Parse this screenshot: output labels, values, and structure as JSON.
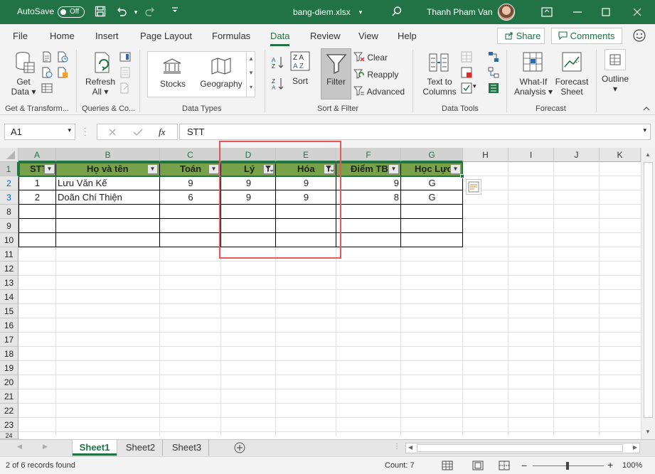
{
  "titlebar": {
    "autosave_label": "AutoSave",
    "autosave_state": "Off",
    "filename": "bang-diem.xlsx",
    "user": "Thanh Pham Van",
    "accent": "#217346"
  },
  "ribbon_tabs": [
    "File",
    "Home",
    "Insert",
    "Page Layout",
    "Formulas",
    "Data",
    "Review",
    "View",
    "Help"
  ],
  "active_tab": "Data",
  "share_label": "Share",
  "comments_label": "Comments",
  "ribbon": {
    "get_data": "Get",
    "get_data2": "Data",
    "refresh": "Refresh",
    "refresh2": "All",
    "stocks": "Stocks",
    "geography": "Geography",
    "sort": "Sort",
    "filter": "Filter",
    "clear": "Clear",
    "reapply": "Reapply",
    "advanced": "Advanced",
    "text_to_columns": "Text to",
    "text_to_columns2": "Columns",
    "whatif": "What-If",
    "whatif2": "Analysis",
    "forecast": "Forecast",
    "forecast2": "Sheet",
    "outline": "Outline",
    "groups": {
      "get_transform": "Get & Transform...",
      "queries": "Queries & Co...",
      "data_types": "Data Types",
      "sort_filter": "Sort & Filter",
      "data_tools": "Data Tools",
      "forecast": "Forecast"
    }
  },
  "formula_bar": {
    "name_box": "A1",
    "fx": "fx",
    "content": "STT"
  },
  "grid": {
    "columns": [
      "A",
      "B",
      "C",
      "D",
      "E",
      "F",
      "G",
      "H",
      "I",
      "J",
      "K"
    ],
    "rows": [
      "1",
      "2",
      "3",
      "8",
      "9",
      "10",
      "11",
      "12",
      "13",
      "14",
      "15",
      "16",
      "17",
      "18",
      "19",
      "20",
      "21",
      "22",
      "23",
      "24"
    ],
    "headers": [
      "STT",
      "Họ và tên",
      "Toán",
      "Lý",
      "Hóa",
      "Điểm TB",
      "Học Lực"
    ],
    "data": [
      [
        "1",
        "Lưu Văn Kế",
        "9",
        "9",
        "9",
        "9",
        "G"
      ],
      [
        "2",
        "Doãn Chí Thiện",
        "6",
        "9",
        "9",
        "8",
        "G"
      ]
    ]
  },
  "sheets": [
    "Sheet1",
    "Sheet2",
    "Sheet3"
  ],
  "active_sheet": "Sheet1",
  "status": {
    "records": "2 of 6 records found",
    "count": "Count: 7",
    "zoom": "100%"
  }
}
